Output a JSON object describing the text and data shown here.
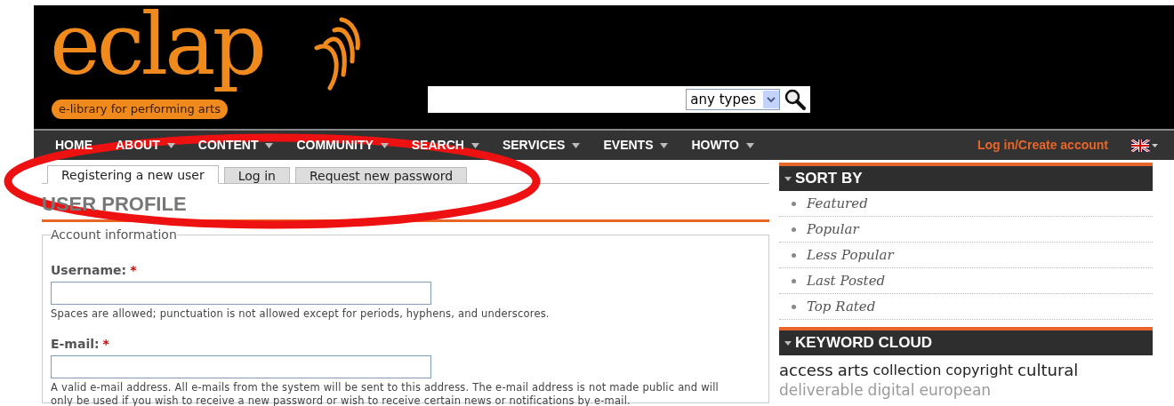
{
  "header": {
    "logo_text": "eclap",
    "tagline": "e-library for performing arts",
    "search": {
      "type_select": "any types"
    }
  },
  "nav": {
    "items": [
      {
        "label": "HOME",
        "has_menu": false
      },
      {
        "label": "ABOUT",
        "has_menu": true
      },
      {
        "label": "CONTENT",
        "has_menu": true
      },
      {
        "label": "COMMUNITY",
        "has_menu": true
      },
      {
        "label": "SEARCH",
        "has_menu": true
      },
      {
        "label": "SERVICES",
        "has_menu": true
      },
      {
        "label": "EVENTS",
        "has_menu": true
      },
      {
        "label": "HOWTO",
        "has_menu": true
      }
    ],
    "login": "Log in/Create account"
  },
  "tabs": [
    {
      "label": "Registering a new user",
      "selected": true
    },
    {
      "label": "Log in",
      "selected": false
    },
    {
      "label": "Request new password",
      "selected": false
    }
  ],
  "page_title": "USER PROFILE",
  "fieldset": {
    "legend": "Account information",
    "fields": [
      {
        "label": "Username:",
        "required_mark": "*",
        "help": "Spaces are allowed; punctuation is not allowed except for periods, hyphens, and underscores."
      },
      {
        "label": "E-mail:",
        "required_mark": "*",
        "help": "A valid e-mail address. All e-mails from the system will be sent to this address. The e-mail address is not made public and will only be used if you wish to receive a new password or wish to receive certain news or notifications by e-mail."
      }
    ]
  },
  "sidebar": {
    "sort_by": {
      "title": "SORT BY",
      "items": [
        "Featured",
        "Popular",
        "Less Popular",
        "Last Posted",
        "Top Rated"
      ]
    },
    "keyword_cloud": {
      "title": "KEYWORD CLOUD",
      "words": [
        {
          "text": "access",
          "kind": "large"
        },
        {
          "text": "arts",
          "kind": "large"
        },
        {
          "text": "collection",
          "kind": "medium"
        },
        {
          "text": "copyright",
          "kind": "medium"
        },
        {
          "text": "cultural",
          "kind": "large"
        },
        {
          "text": "deliverable",
          "kind": "faded"
        },
        {
          "text": "digital",
          "kind": "faded"
        },
        {
          "text": "european",
          "kind": "faded"
        }
      ]
    }
  },
  "annotation": {
    "kind": "ellipse",
    "color": "#ee1111"
  }
}
